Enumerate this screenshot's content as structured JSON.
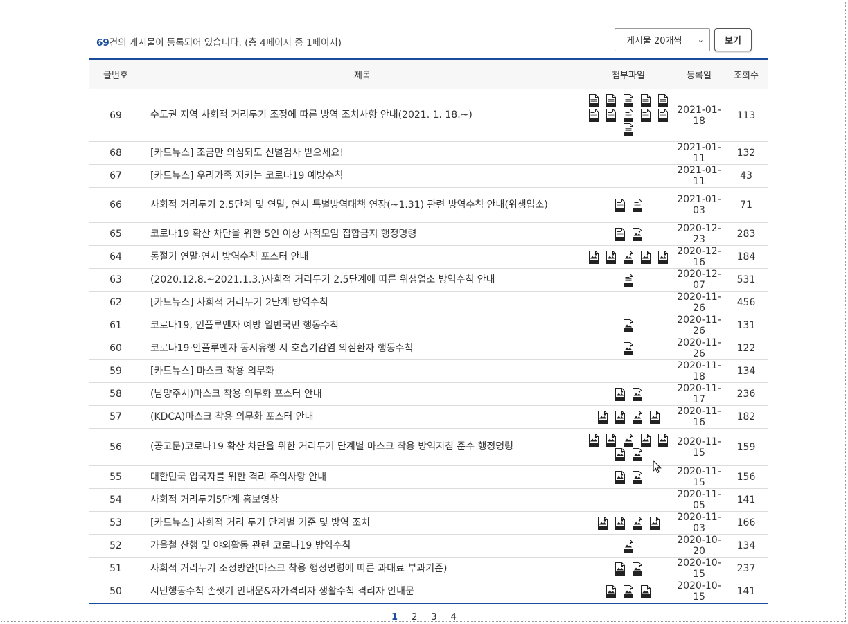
{
  "summary": {
    "count": "69",
    "text": "건의 게시물이 등록되어 있습니다. (총 4페이지 중 1페이지)"
  },
  "controls": {
    "per_page": "게시물 20개씩",
    "view_label": "보기"
  },
  "columns": [
    "글번호",
    "제목",
    "첨부파일",
    "등록일",
    "조회수"
  ],
  "rows": [
    {
      "no": "69",
      "title": "수도권 지역 사회적 거리두기 조정에 따른 방역 조치사항 안내(2021. 1. 18.~)",
      "files": [
        "hwp",
        "hwp",
        "hwp",
        "hwp",
        "hwp",
        "hwp",
        "hwp",
        "hwp",
        "hwp",
        "hwp",
        "hwp"
      ],
      "date": "2021-01-18",
      "views": "113"
    },
    {
      "no": "68",
      "title": "[카드뉴스] 조금만 의심되도 선별검사 받으세요!",
      "files": [],
      "date": "2021-01-11",
      "views": "132"
    },
    {
      "no": "67",
      "title": "[카드뉴스] 우리가족 지키는 코로나19 예방수칙",
      "files": [],
      "date": "2021-01-11",
      "views": "43"
    },
    {
      "no": "66",
      "title": "사회적 거리두기 2.5단계 및 연말, 연시 특별방역대책 연장(~1.31) 관련 방역수칙 안내(위생업소)",
      "files": [
        "hwp",
        "hwp"
      ],
      "date": "2021-01-03",
      "views": "71"
    },
    {
      "no": "65",
      "title": "코로나19 확산 차단을 위한 5인 이상 사적모임 집합금지 행정명령",
      "files": [
        "hwp",
        "jpg"
      ],
      "date": "2020-12-23",
      "views": "283"
    },
    {
      "no": "64",
      "title": "동절기 연말·연시 방역수칙 포스터 안내",
      "files": [
        "jpg",
        "jpg",
        "jpg",
        "jpg",
        "jpg"
      ],
      "date": "2020-12-16",
      "views": "184"
    },
    {
      "no": "63",
      "title": "(2020.12.8.~2021.1.3.)사회적 거리두기 2.5단계에 따른 위생업소 방역수칙 안내",
      "files": [
        "hwp"
      ],
      "date": "2020-12-07",
      "views": "531"
    },
    {
      "no": "62",
      "title": "[카드뉴스] 사회적 거리두기 2단계 방역수칙",
      "files": [],
      "date": "2020-11-26",
      "views": "456"
    },
    {
      "no": "61",
      "title": "코로나19, 인플루엔자 예방 일반국민 행동수칙",
      "files": [
        "jpg"
      ],
      "date": "2020-11-26",
      "views": "131"
    },
    {
      "no": "60",
      "title": "코로나19·인플루엔자 동시유행 시 호흡기감염 의심환자 행동수칙",
      "files": [
        "jpg"
      ],
      "date": "2020-11-26",
      "views": "122"
    },
    {
      "no": "59",
      "title": "[카드뉴스] 마스크 착용 의무화",
      "files": [],
      "date": "2020-11-18",
      "views": "134"
    },
    {
      "no": "58",
      "title": "(남양주시)마스크 착용 의무화 포스터 안내",
      "files": [
        "jpg",
        "jpg"
      ],
      "date": "2020-11-17",
      "views": "236"
    },
    {
      "no": "57",
      "title": "(KDCA)마스크 착용 의무화 포스터 안내",
      "files": [
        "jpg",
        "jpg",
        "jpg",
        "jpg"
      ],
      "date": "2020-11-16",
      "views": "182"
    },
    {
      "no": "56",
      "title": "(공고문)코로나19 확산 차단을 위한 거리두기 단계별 마스크 착용 방역지침 준수 행정명령",
      "files": [
        "pdf",
        "jpg",
        "jpg",
        "jpg",
        "jpg",
        "jpg",
        "jpg"
      ],
      "date": "2020-11-15",
      "views": "159"
    },
    {
      "no": "55",
      "title": "대한민국 입국자를 위한 격리 주의사항 안내",
      "files": [
        "jpg",
        "jpg"
      ],
      "date": "2020-11-15",
      "views": "156"
    },
    {
      "no": "54",
      "title": "사회적 거리두기5단계 홍보영상",
      "files": [],
      "date": "2020-11-05",
      "views": "141"
    },
    {
      "no": "53",
      "title": "[카드뉴스] 사회적 거리 두기 단계별 기준 및 방역 조치",
      "files": [
        "pdf",
        "jpg",
        "jpg",
        "jpg"
      ],
      "date": "2020-11-03",
      "views": "166"
    },
    {
      "no": "52",
      "title": "가을철 산행 및 야외활동 관련 코로나19 방역수칙",
      "files": [
        "jpg"
      ],
      "date": "2020-10-20",
      "views": "134"
    },
    {
      "no": "51",
      "title": "사회적 거리두기 조정방안(마스크 착용 행정명령에 따른 과태료 부과기준)",
      "files": [
        "pdf",
        "jpg"
      ],
      "date": "2020-10-15",
      "views": "237"
    },
    {
      "no": "50",
      "title": "시민행동수칙 손씻기 안내문&자가격리자 생활수칙 격리자 안내문",
      "files": [
        "jpg",
        "jpg",
        "jpg"
      ],
      "date": "2020-10-15",
      "views": "141"
    }
  ],
  "pagination": {
    "pages": [
      "1",
      "2",
      "3",
      "4"
    ],
    "current": "1"
  },
  "colors": {
    "accent": "#1a4c9c"
  }
}
